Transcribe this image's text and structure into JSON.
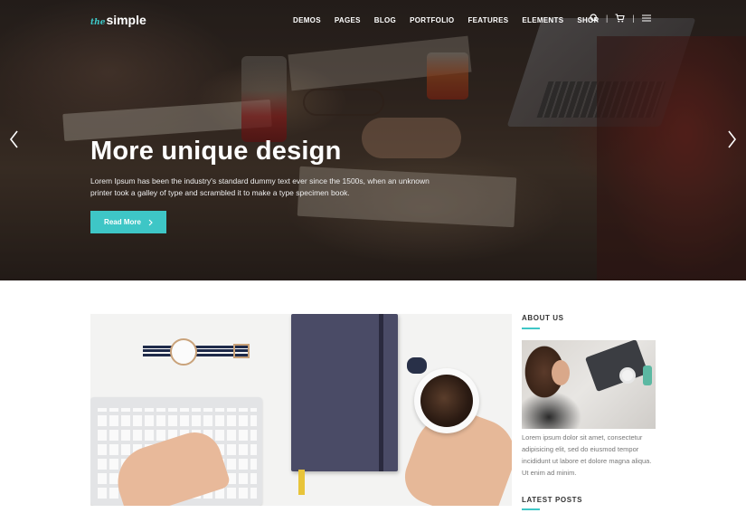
{
  "brand": {
    "prefix": "the",
    "name": "simple"
  },
  "nav": {
    "items": [
      "DEMOS",
      "PAGES",
      "BLOG",
      "PORTFOLIO",
      "FEATURES",
      "ELEMENTS",
      "SHOP"
    ],
    "icons": [
      "search-icon",
      "cart-icon",
      "menu-icon"
    ],
    "separator": "|"
  },
  "hero": {
    "title": "More unique design",
    "text": "Lorem Ipsum has been the industry's standard dummy text ever since the 1500s, when an unknown printer took a galley of type and scrambled it to make a type specimen book.",
    "button_label": "Read More",
    "prev_icon": "chevron-left-icon",
    "next_icon": "chevron-right-icon"
  },
  "sidebar": {
    "about_heading": "ABOUT US",
    "about_text": "Lorem ipsum dolor sit amet, consectetur adipisicing elit, sed do eiusmod tempor incididunt ut labore et dolore magna aliqua. Ut enim ad minim.",
    "latest_heading": "LATEST POSTS"
  },
  "colors": {
    "accent": "#3ec6c6",
    "hero_text": "#ffffff",
    "body_text": "#777777"
  }
}
